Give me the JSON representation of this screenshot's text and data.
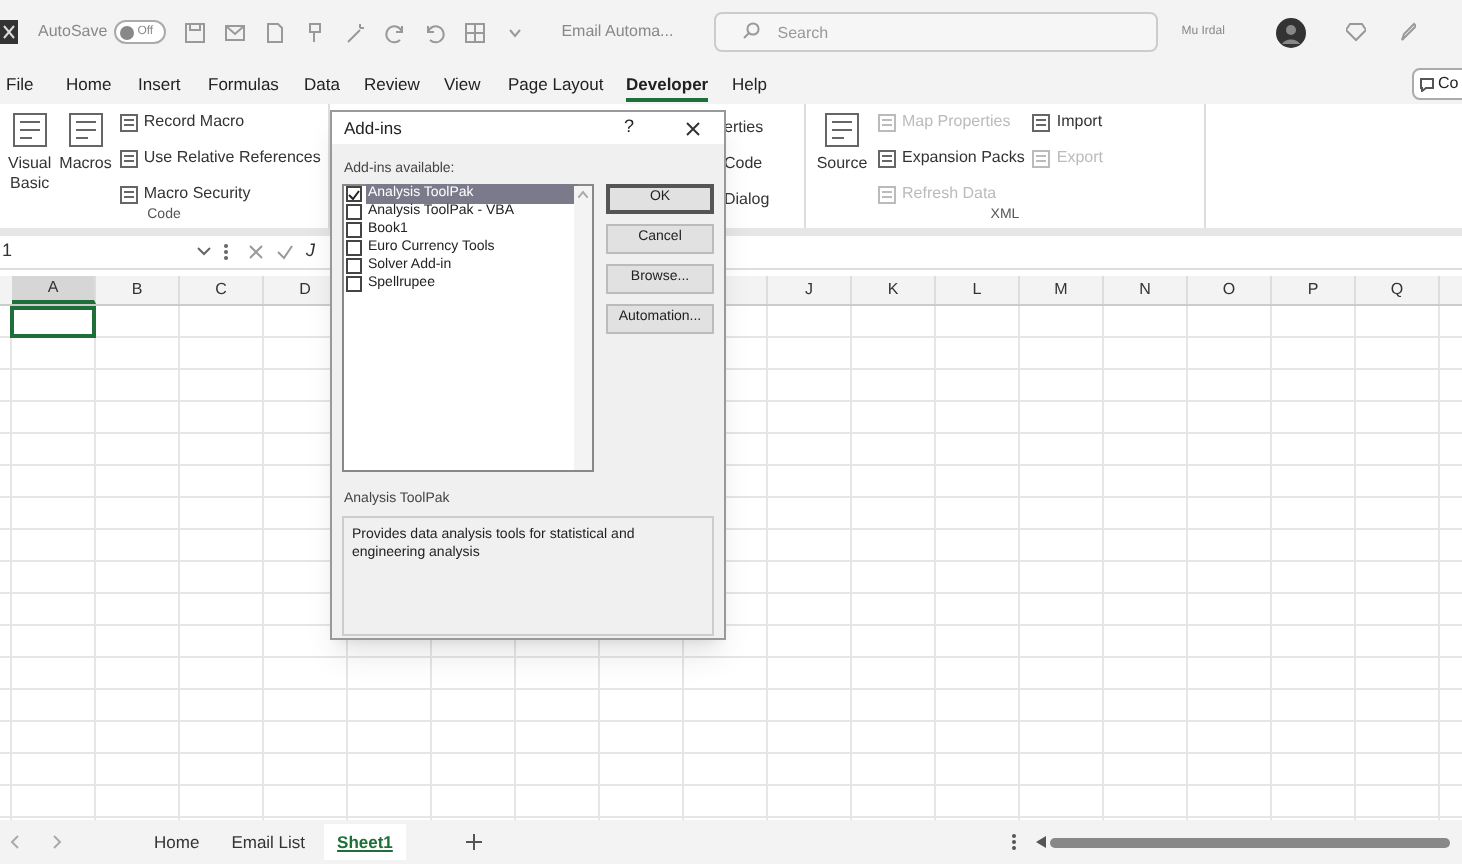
{
  "title_bar": {
    "autosave_label": "AutoSave",
    "autosave_toggle": {
      "label": "Off",
      "on": false
    },
    "document_title": "Email Automa...",
    "search": {
      "placeholder": "Search"
    },
    "user_name": "Mu Irdal"
  },
  "menu_tabs": [
    {
      "label": "File",
      "selected": false
    },
    {
      "label": "Home",
      "selected": false
    },
    {
      "label": "Insert",
      "selected": false
    },
    {
      "label": "Formulas",
      "selected": false
    },
    {
      "label": "Data",
      "selected": false
    },
    {
      "label": "Review",
      "selected": false
    },
    {
      "label": "View",
      "selected": false
    },
    {
      "label": "Page Layout",
      "selected": false
    },
    {
      "label": "Developer",
      "selected": true
    },
    {
      "label": "Help",
      "selected": false
    }
  ],
  "comments_button": "Co",
  "ribbon": {
    "code_group": {
      "label": "Code",
      "buttons": [
        {
          "label": "Visual Basic",
          "kind": "large",
          "disabled": false
        },
        {
          "label": "Macros",
          "kind": "large",
          "disabled": false
        },
        {
          "label": "Record Macro",
          "kind": "small",
          "disabled": false
        },
        {
          "label": "Use Relative References",
          "kind": "small",
          "disabled": false
        },
        {
          "label": "Macro Security",
          "kind": "small",
          "disabled": false
        }
      ]
    },
    "partial_group": {
      "items": [
        "erties",
        "Code",
        "Dialog"
      ]
    },
    "xml_group": {
      "label": "XML",
      "buttons": [
        {
          "label": "Source",
          "kind": "large",
          "disabled": false
        },
        {
          "label": "Map Properties",
          "kind": "small",
          "disabled": true
        },
        {
          "label": "Expansion Packs",
          "kind": "small",
          "disabled": false
        },
        {
          "label": "Refresh Data",
          "kind": "small",
          "disabled": true
        },
        {
          "label": "Import",
          "kind": "small",
          "disabled": false
        },
        {
          "label": "Export",
          "kind": "small",
          "disabled": true
        }
      ]
    }
  },
  "formula_bar": {
    "name_box": "1",
    "function_label": "J"
  },
  "columns": [
    {
      "label": "A",
      "selected": true
    },
    {
      "label": "B",
      "selected": false
    },
    {
      "label": "C",
      "selected": false
    },
    {
      "label": "D",
      "selected": false
    },
    {
      "label": "J",
      "selected": false
    },
    {
      "label": "K",
      "selected": false
    },
    {
      "label": "L",
      "selected": false
    },
    {
      "label": "M",
      "selected": false
    },
    {
      "label": "N",
      "selected": false
    },
    {
      "label": "O",
      "selected": false
    },
    {
      "label": "P",
      "selected": false
    },
    {
      "label": "Q",
      "selected": false
    }
  ],
  "sheet_tabs": [
    {
      "label": "Home",
      "selected": false
    },
    {
      "label": "Email List",
      "selected": false
    },
    {
      "label": "Sheet1",
      "selected": true
    }
  ],
  "dialog": {
    "title": "Add-ins",
    "help": "?",
    "list_label": "Add-ins available:",
    "items": [
      {
        "label": "Analysis ToolPak",
        "checked": true,
        "selected": true
      },
      {
        "label": "Analysis ToolPak - VBA",
        "checked": false,
        "selected": false
      },
      {
        "label": "Book1",
        "checked": false,
        "selected": false
      },
      {
        "label": "Euro Currency Tools",
        "checked": false,
        "selected": false
      },
      {
        "label": "Solver Add-in",
        "checked": false,
        "selected": false
      },
      {
        "label": "Spellrupee",
        "checked": false,
        "selected": false
      }
    ],
    "buttons": [
      {
        "label": "OK",
        "default": true
      },
      {
        "label": "Cancel",
        "default": false
      },
      {
        "label": "Browse...",
        "default": false
      },
      {
        "label": "Automation...",
        "default": false
      }
    ],
    "selected_name": "Analysis ToolPak",
    "description": "Provides data analysis tools for statistical and engineering analysis"
  }
}
